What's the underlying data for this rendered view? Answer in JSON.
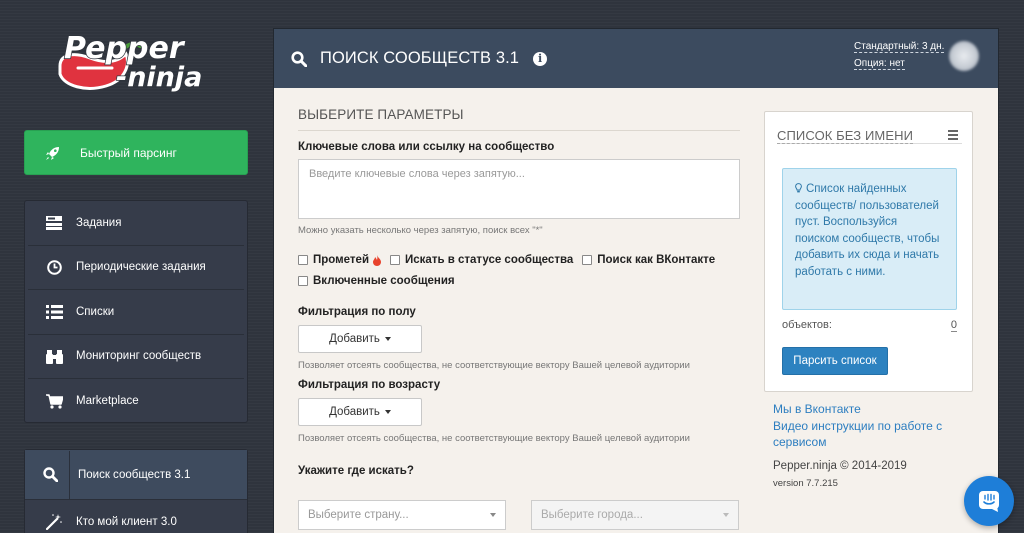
{
  "logo": {
    "line1": "Pepper",
    "line2": "-ninja"
  },
  "sidebar": {
    "quick_parse": {
      "label": "Быстрый парсинг",
      "icon": "rocket-icon"
    },
    "items": [
      {
        "label": "Задания",
        "icon": "tasks-icon"
      },
      {
        "label": "Периодические задания",
        "icon": "clock-icon"
      },
      {
        "label": "Списки",
        "icon": "list-icon"
      },
      {
        "label": "Мониторинг сообществ",
        "icon": "binoculars-icon"
      },
      {
        "label": "Marketplace",
        "icon": "cart-icon"
      }
    ],
    "secondary": [
      {
        "label": "Поиск сообществ 3.1",
        "icon": "search-icon",
        "active": true
      },
      {
        "label": "Кто мой клиент 3.0",
        "icon": "magic-wand-icon"
      }
    ]
  },
  "header": {
    "title": "ПОИСК СООБЩЕСТВ 3.1",
    "plan": "Стандартный: 3 дн.",
    "option": "Опция: нет"
  },
  "form": {
    "section_title": "ВЫБЕРИТЕ ПАРАМЕТРЫ",
    "keywords_label": "Ключевые слова или ссылку на сообщество",
    "keywords_placeholder": "Введите ключевые слова через запятую...",
    "keywords_hint": "Можно указать несколько через запятую, поиск всех \"*\"",
    "checkboxes": [
      "Прометей",
      "Искать в статусе сообщества",
      "Поиск как ВКонтакте",
      "Включенные сообщения"
    ],
    "gender_label": "Фильтрация по полу",
    "gender_button": "Добавить",
    "gender_hint": "Позволяет отсеять сообщества, не соответствующие вектору Вашей целевой аудитории",
    "age_label": "Фильтрация по возрасту",
    "age_button": "Добавить",
    "age_hint": "Позволяет отсеять сообщества, не соответствующие вектору Вашей целевой аудитории",
    "where_label": "Укажите где искать?",
    "country_placeholder": "Выберите страну...",
    "city_placeholder": "Выберите города..."
  },
  "widget": {
    "title": "СПИСОК БЕЗ ИМЕНИ",
    "alert": "Список найденных сообществ/ пользователей пуст. Воспользуйся поиском сообществ, чтобы добавить их сюда и начать работать с ними.",
    "objects_label": "объектов:",
    "objects_count": "0",
    "parse_button": "Парсить список"
  },
  "footer": {
    "link_vk": "Мы в Вконтакте",
    "link_video": "Видео инструкции по работе с сервисом",
    "copyright": "Pepper.ninja © 2014-2019",
    "version": "version 7.7.215"
  },
  "colors": {
    "background": "#2f343d",
    "quick_parse": "#2fb45d",
    "header": "#3c4b5f",
    "link": "#2d7ec0",
    "parse_button": "#2d82c0",
    "alert_bg": "#d9edf7",
    "chat": "#1e7ed8"
  }
}
